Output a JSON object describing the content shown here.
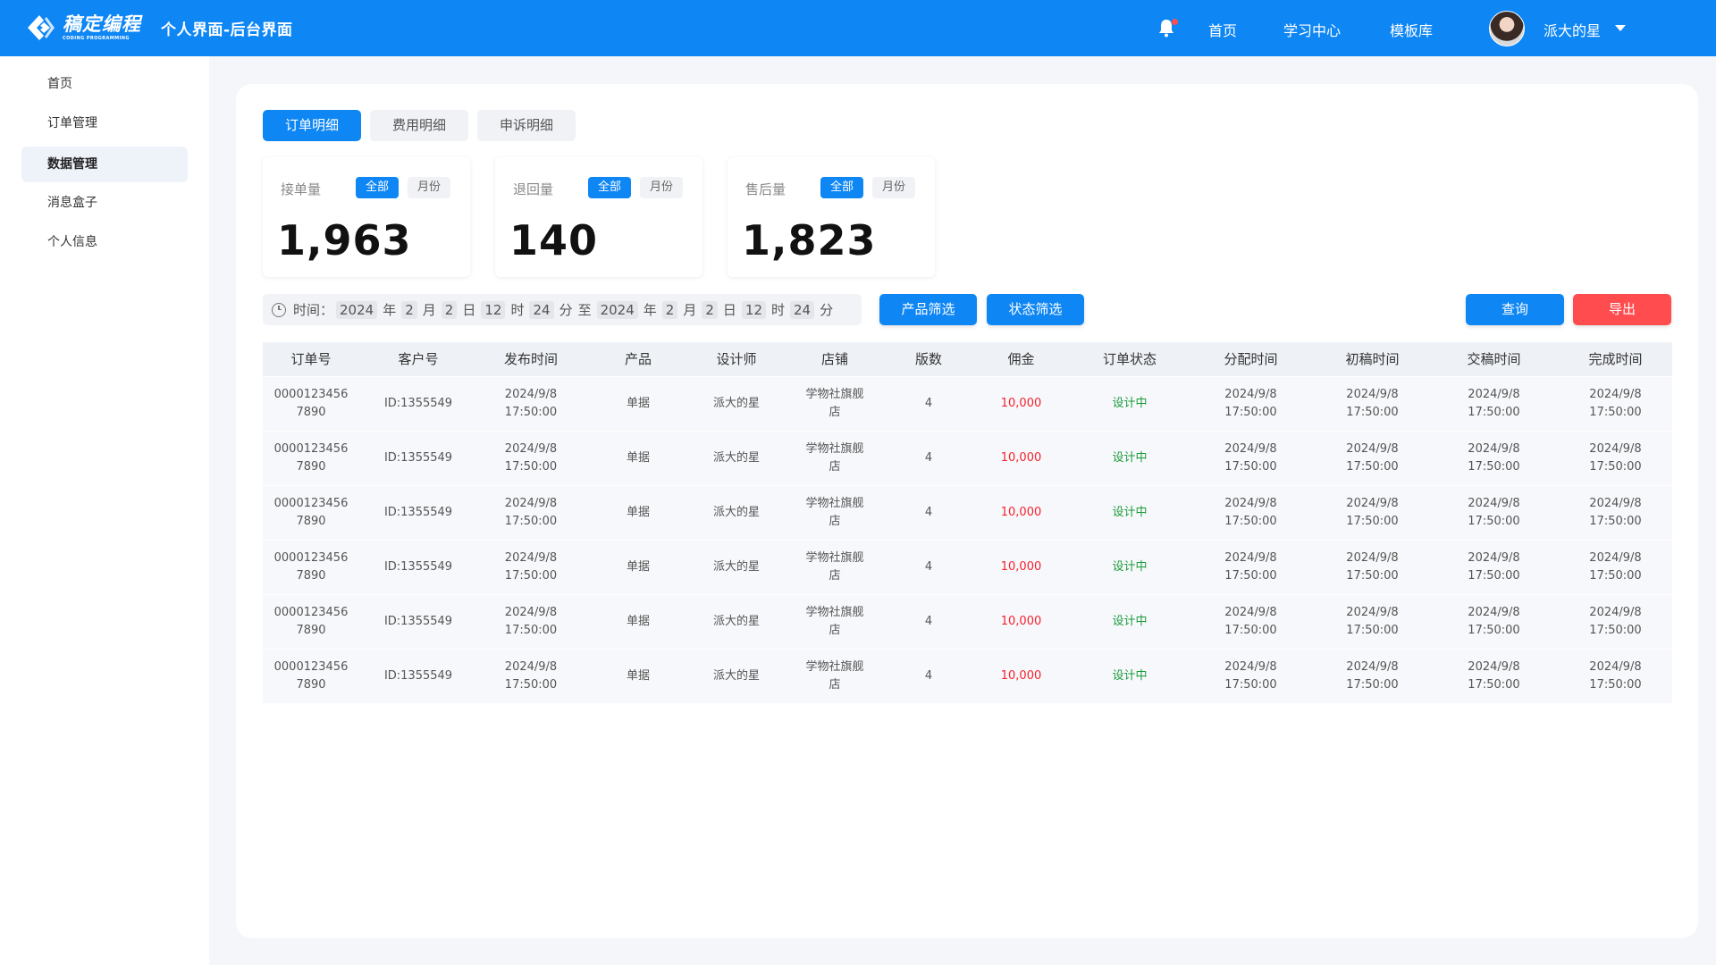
{
  "brand": {
    "cn": "稿定编程",
    "en": "CODING PROGRAMMING",
    "accent": "#0e86f4",
    "danger": "#ff4d4f",
    "success": "#1a9b3a"
  },
  "header": {
    "title": "个人界面-后台界面",
    "nav": [
      "首页",
      "学习中心",
      "模板库"
    ],
    "user": {
      "name": "派大的星"
    },
    "icons": [
      "bell-icon",
      "avatar",
      "chevron-down-icon"
    ]
  },
  "sidebar": {
    "items": [
      "首页",
      "订单管理",
      "数据管理",
      "消息盒子",
      "个人信息"
    ],
    "active_index": 2
  },
  "tabs": {
    "items": [
      "订单明细",
      "费用明细",
      "申诉明细"
    ],
    "active_index": 0
  },
  "stats": [
    {
      "label": "接单量",
      "all": "全部",
      "month": "月份",
      "value": "1,963"
    },
    {
      "label": "退回量",
      "all": "全部",
      "month": "月份",
      "value": "140"
    },
    {
      "label": "售后量",
      "all": "全部",
      "month": "月份",
      "value": "1,823"
    }
  ],
  "date_filter": {
    "label": "时间：",
    "from": {
      "year": "2024",
      "month": "2",
      "day": "2",
      "hour": "12",
      "minute": "24"
    },
    "sep": "至",
    "to": {
      "year": "2024",
      "month": "2",
      "day": "2",
      "hour": "12",
      "minute": "24"
    },
    "units": {
      "year": "年",
      "month": "月",
      "day": "日",
      "hour": "时",
      "minute": "分"
    }
  },
  "filters": {
    "product": "产品筛选",
    "status": "状态筛选"
  },
  "actions": {
    "query": "查询",
    "export": "导出"
  },
  "table": {
    "columns": [
      "订单号",
      "客户号",
      "发布时间",
      "产品",
      "设计师",
      "店铺",
      "版数",
      "佣金",
      "订单状态",
      "分配时间",
      "初稿时间",
      "交稿时间",
      "完成时间"
    ],
    "rows": [
      {
        "order_a": "0000123456",
        "order_b": "7890",
        "customer": "ID:1355549",
        "publish_date": "2024/9/8",
        "publish_time": "17:50:00",
        "product": "单据",
        "designer": "派大的星",
        "shop_a": "学物社旗舰",
        "shop_b": "店",
        "versions": "4",
        "commission": "10,000",
        "status": "设计中",
        "assign_date": "2024/9/8",
        "assign_time": "17:50:00",
        "draft_date": "2024/9/8",
        "draft_time": "17:50:00",
        "deliver_date": "2024/9/8",
        "deliver_time": "17:50:00",
        "done_date": "2024/9/8",
        "done_time": "17:50:00"
      },
      {
        "order_a": "0000123456",
        "order_b": "7890",
        "customer": "ID:1355549",
        "publish_date": "2024/9/8",
        "publish_time": "17:50:00",
        "product": "单据",
        "designer": "派大的星",
        "shop_a": "学物社旗舰",
        "shop_b": "店",
        "versions": "4",
        "commission": "10,000",
        "status": "设计中",
        "assign_date": "2024/9/8",
        "assign_time": "17:50:00",
        "draft_date": "2024/9/8",
        "draft_time": "17:50:00",
        "deliver_date": "2024/9/8",
        "deliver_time": "17:50:00",
        "done_date": "2024/9/8",
        "done_time": "17:50:00"
      },
      {
        "order_a": "0000123456",
        "order_b": "7890",
        "customer": "ID:1355549",
        "publish_date": "2024/9/8",
        "publish_time": "17:50:00",
        "product": "单据",
        "designer": "派大的星",
        "shop_a": "学物社旗舰",
        "shop_b": "店",
        "versions": "4",
        "commission": "10,000",
        "status": "设计中",
        "assign_date": "2024/9/8",
        "assign_time": "17:50:00",
        "draft_date": "2024/9/8",
        "draft_time": "17:50:00",
        "deliver_date": "2024/9/8",
        "deliver_time": "17:50:00",
        "done_date": "2024/9/8",
        "done_time": "17:50:00"
      },
      {
        "order_a": "0000123456",
        "order_b": "7890",
        "customer": "ID:1355549",
        "publish_date": "2024/9/8",
        "publish_time": "17:50:00",
        "product": "单据",
        "designer": "派大的星",
        "shop_a": "学物社旗舰",
        "shop_b": "店",
        "versions": "4",
        "commission": "10,000",
        "status": "设计中",
        "assign_date": "2024/9/8",
        "assign_time": "17:50:00",
        "draft_date": "2024/9/8",
        "draft_time": "17:50:00",
        "deliver_date": "2024/9/8",
        "deliver_time": "17:50:00",
        "done_date": "2024/9/8",
        "done_time": "17:50:00"
      },
      {
        "order_a": "0000123456",
        "order_b": "7890",
        "customer": "ID:1355549",
        "publish_date": "2024/9/8",
        "publish_time": "17:50:00",
        "product": "单据",
        "designer": "派大的星",
        "shop_a": "学物社旗舰",
        "shop_b": "店",
        "versions": "4",
        "commission": "10,000",
        "status": "设计中",
        "assign_date": "2024/9/8",
        "assign_time": "17:50:00",
        "draft_date": "2024/9/8",
        "draft_time": "17:50:00",
        "deliver_date": "2024/9/8",
        "deliver_time": "17:50:00",
        "done_date": "2024/9/8",
        "done_time": "17:50:00"
      },
      {
        "order_a": "0000123456",
        "order_b": "7890",
        "customer": "ID:1355549",
        "publish_date": "2024/9/8",
        "publish_time": "17:50:00",
        "product": "单据",
        "designer": "派大的星",
        "shop_a": "学物社旗舰",
        "shop_b": "店",
        "versions": "4",
        "commission": "10,000",
        "status": "设计中",
        "assign_date": "2024/9/8",
        "assign_time": "17:50:00",
        "draft_date": "2024/9/8",
        "draft_time": "17:50:00",
        "deliver_date": "2024/9/8",
        "deliver_time": "17:50:00",
        "done_date": "2024/9/8",
        "done_time": "17:50:00"
      }
    ]
  }
}
